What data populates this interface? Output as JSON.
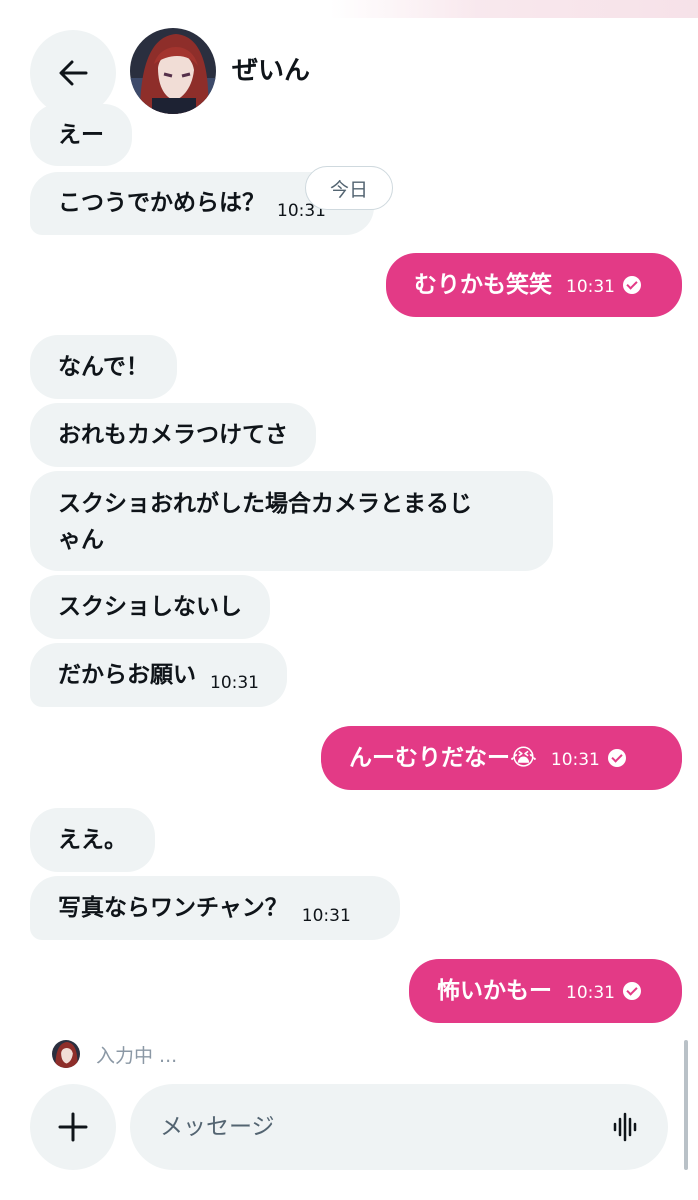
{
  "header": {
    "contact_name": "ぜいん",
    "back_icon": "arrow-left-icon"
  },
  "date_separator": "今日",
  "messages": [
    {
      "dir": "in",
      "text": "えー"
    },
    {
      "dir": "in",
      "text": "こつうでかめらは？",
      "time": "10:31"
    },
    {
      "dir": "out",
      "text": "むりかも笑笑",
      "time": "10:31",
      "status": "sent"
    },
    {
      "dir": "in",
      "text": "なんで！"
    },
    {
      "dir": "in",
      "text": "おれもカメラつけてさ"
    },
    {
      "dir": "in",
      "text_line1": "スクショおれがした場合カメラとまるじ",
      "text_line2": "ゃん"
    },
    {
      "dir": "in",
      "text": "スクショしないし"
    },
    {
      "dir": "in",
      "text": "だからお願い",
      "time": "10:31"
    },
    {
      "dir": "out",
      "text": "んーむりだなー",
      "emoji": "😭",
      "time": "10:31",
      "status": "sent"
    },
    {
      "dir": "in",
      "text": "ええ。"
    },
    {
      "dir": "in",
      "text": "写真ならワンチャン？",
      "time": "10:31"
    },
    {
      "dir": "out",
      "text": "怖いかもー",
      "time": "10:31",
      "status": "sent"
    }
  ],
  "typing_indicator": "入力中 ...",
  "composer": {
    "placeholder": "メッセージ",
    "add_icon": "plus-icon",
    "voice_icon": "voice-waveform-icon"
  },
  "colors": {
    "outgoing_bubble": "#e33a86",
    "incoming_bubble": "#eff3f4",
    "text": "#0f1419",
    "muted": "#536471"
  }
}
